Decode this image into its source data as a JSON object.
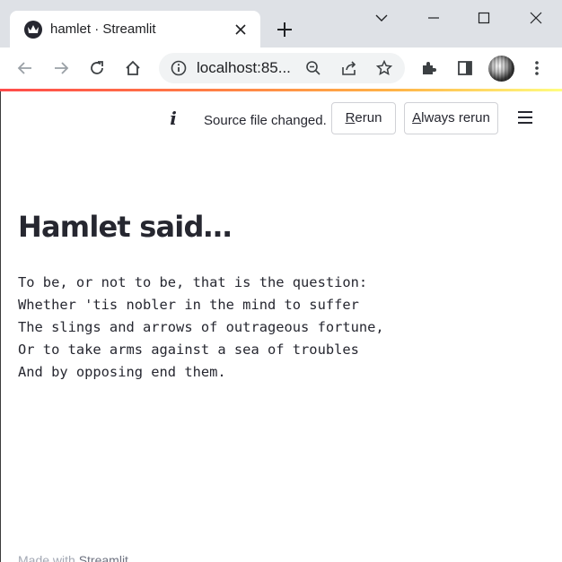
{
  "browser": {
    "tab": {
      "title": "hamlet · Streamlit",
      "favicon": "streamlit-crown-icon"
    },
    "new_tab_icon": "plus-icon",
    "window_controls": [
      "tab-search-chevron-icon",
      "minimize-icon",
      "maximize-icon",
      "close-icon"
    ],
    "toolbar": {
      "back_icon": "arrow-left-icon",
      "forward_icon": "arrow-right-icon",
      "reload_icon": "reload-icon",
      "home_icon": "home-icon",
      "address": "localhost:85...",
      "omnibox_icons": [
        "zoom-out-icon",
        "share-icon",
        "star-icon"
      ],
      "extensions_icon": "puzzle-icon",
      "side_panel_icon": "side-panel-icon",
      "profile_icon": "avatar",
      "menu_icon": "kebab-menu-icon"
    }
  },
  "streamlit": {
    "status": {
      "icon": "info-i-icon",
      "message": "Source file changed.",
      "rerun_prefix": "R",
      "rerun_rest": "erun",
      "always_rerun_prefix": "A",
      "always_rerun_rest": "lways rerun"
    },
    "menu_icon": "hamburger-menu-icon",
    "heading": "Hamlet said…",
    "code_lines": [
      "To be, or not to be, that is the question:",
      "Whether 'tis nobler in the mind to suffer",
      "The slings and arrows of outrageous fortune,",
      "Or to take arms against a sea of troubles",
      "And by opposing end them."
    ],
    "footer": {
      "prefix": "Made with ",
      "brand": "Streamlit"
    }
  },
  "colors": {
    "text": "#262730",
    "tabstrip": "#dee1e6",
    "omnibox": "#f1f3f4",
    "accent_red": "#ff4b4b",
    "accent_yellow": "#fffd80"
  }
}
